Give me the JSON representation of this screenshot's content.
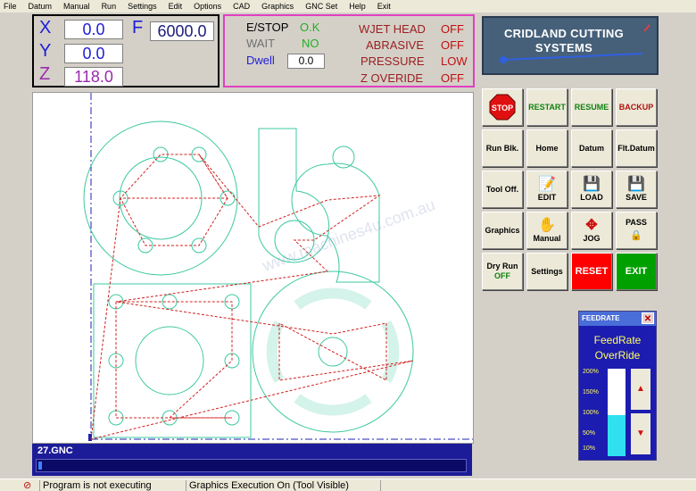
{
  "menu": [
    "File",
    "Datum",
    "Manual",
    "Run",
    "Settings",
    "Edit",
    "Options",
    "CAD",
    "Graphics",
    "GNC Set",
    "Help",
    "Exit"
  ],
  "coords": {
    "x_label": "X",
    "x_value": "0.0",
    "y_label": "Y",
    "y_value": "0.0",
    "z_label": "Z",
    "z_value": "118.0",
    "f_label": "F",
    "f_value": "6000.0"
  },
  "status": {
    "estop_label": "E/STOP",
    "estop_value": "O.K",
    "wait_label": "WAIT",
    "wait_value": "NO",
    "dwell_label": "Dwell",
    "dwell_value": "0.0",
    "wjet_label": "WJET HEAD",
    "wjet_value": "OFF",
    "abrasive_label": "ABRASIVE",
    "abrasive_value": "OFF",
    "pressure_label": "PRESSURE",
    "pressure_value": "LOW",
    "zoveride_label": "Z OVERIDE",
    "zoveride_value": "OFF"
  },
  "logo": {
    "line1": "CRIDLAND CUTTING",
    "line2": "SYSTEMS"
  },
  "buttons": {
    "stop": "STOP",
    "restart": "RESTART",
    "resume": "RESUME",
    "backup": "BACKUP",
    "run_blk": "Run Blk.",
    "home": "Home",
    "datum": "Datum",
    "flt_datum": "Flt.Datum",
    "tool_off": "Tool Off.",
    "edit": "EDIT",
    "load": "LOAD",
    "save": "SAVE",
    "graphics": "Graphics",
    "manual": "Manual",
    "jog": "JOG",
    "pass": "PASS",
    "dry_run": "Dry Run",
    "dry_run_state": "OFF",
    "settings": "Settings",
    "reset": "RESET",
    "exit": "EXIT"
  },
  "feed": {
    "title": "FEEDRATE",
    "close": "✕",
    "label1": "FeedRate",
    "label2": "OverRide",
    "ticks": [
      "200%",
      "150%",
      "100%",
      "50%",
      "10%"
    ],
    "level_percent": 100,
    "up": "▲",
    "down": "▼"
  },
  "file": {
    "name": "27.GNC"
  },
  "statusbar": {
    "left": "Program is not executing",
    "right": "Graphics Execution On (Tool Visible)"
  },
  "colors": {
    "axis_blue": "#1d1dd8",
    "z_purple": "#9a2ab0",
    "ok_green": "#20b020",
    "off_red": "#c01010",
    "cut_green": "#3cc8a0",
    "path_red": "#d02020",
    "reset_red": "#ff0000",
    "exit_green": "#00a000"
  }
}
